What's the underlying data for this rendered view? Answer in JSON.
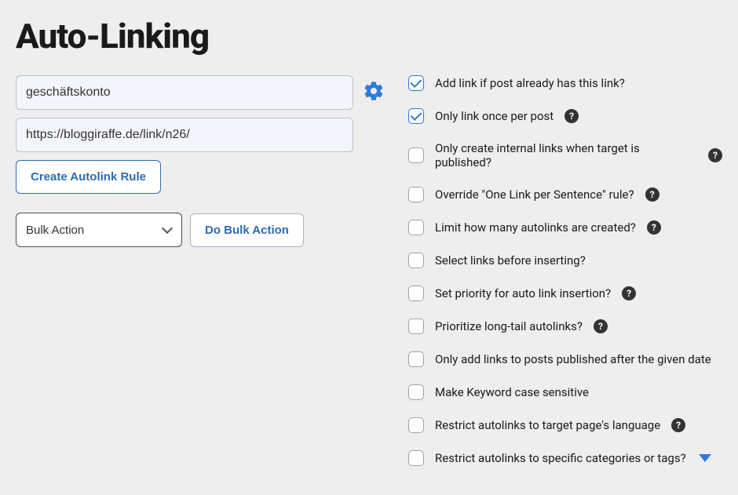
{
  "page": {
    "title": "Auto-Linking"
  },
  "form": {
    "keyword_value": "geschäftskonto",
    "url_value": "https://bloggiraffe.de/link/n26/",
    "create_button": "Create Autolink Rule",
    "bulk_select_value": "Bulk Action",
    "do_bulk_button": "Do Bulk Action"
  },
  "options": [
    {
      "label": "Add link if post already has this link?",
      "checked": true,
      "help": false,
      "expand": false
    },
    {
      "label": "Only link once per post",
      "checked": true,
      "help": true,
      "expand": false
    },
    {
      "label": "Only create internal links when target is published?",
      "checked": false,
      "help": true,
      "expand": false
    },
    {
      "label": "Override \"One Link per Sentence\" rule?",
      "checked": false,
      "help": true,
      "expand": false
    },
    {
      "label": "Limit how many autolinks are created?",
      "checked": false,
      "help": true,
      "expand": false
    },
    {
      "label": "Select links before inserting?",
      "checked": false,
      "help": false,
      "expand": false
    },
    {
      "label": "Set priority for auto link insertion?",
      "checked": false,
      "help": true,
      "expand": false
    },
    {
      "label": "Prioritize long-tail autolinks?",
      "checked": false,
      "help": true,
      "expand": false
    },
    {
      "label": "Only add links to posts published after the given date",
      "checked": false,
      "help": false,
      "expand": false
    },
    {
      "label": "Make Keyword case sensitive",
      "checked": false,
      "help": false,
      "expand": false
    },
    {
      "label": "Restrict autolinks to target page's language",
      "checked": false,
      "help": true,
      "expand": false
    },
    {
      "label": "Restrict autolinks to specific categories or tags?",
      "checked": false,
      "help": false,
      "expand": true
    }
  ]
}
